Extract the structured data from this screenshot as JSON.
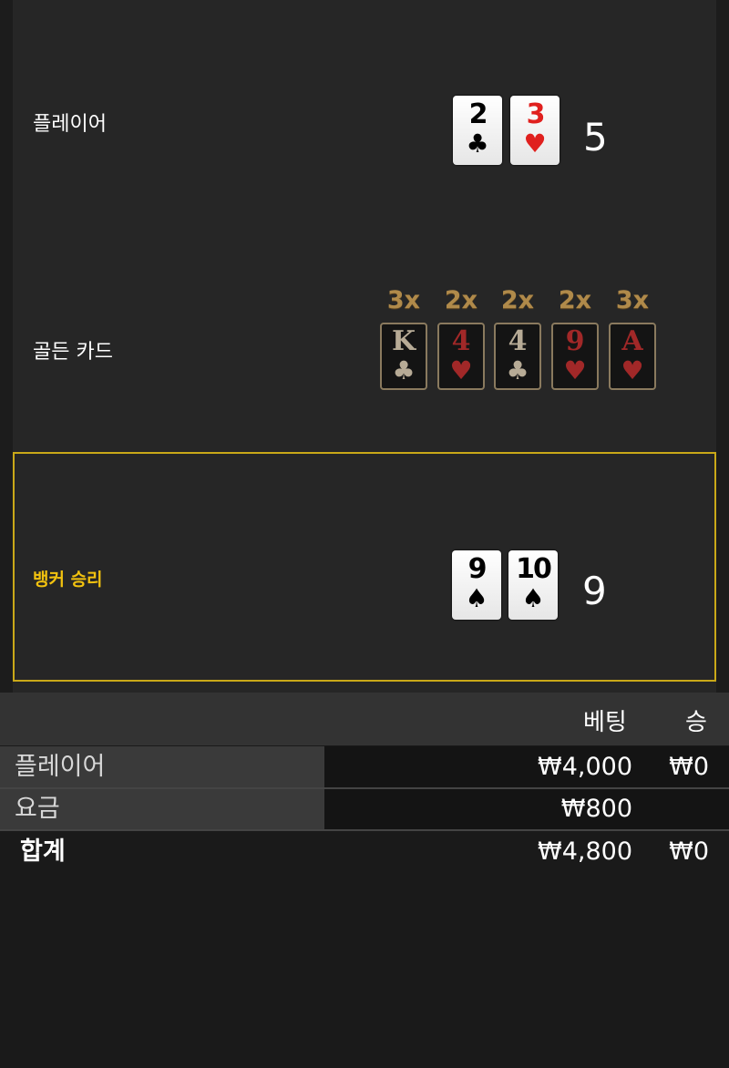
{
  "player": {
    "label": "플레이어",
    "cards": [
      {
        "rank": "2",
        "suit": "♣",
        "color": "black"
      },
      {
        "rank": "3",
        "suit": "♥",
        "color": "red"
      }
    ],
    "total": "5"
  },
  "golden": {
    "label": "골든 카드",
    "cards": [
      {
        "mult": "3x",
        "rank": "K",
        "suit": "♣",
        "color": "dark"
      },
      {
        "mult": "2x",
        "rank": "4",
        "suit": "♥",
        "color": "red"
      },
      {
        "mult": "2x",
        "rank": "4",
        "suit": "♣",
        "color": "dark"
      },
      {
        "mult": "2x",
        "rank": "9",
        "suit": "♥",
        "color": "red"
      },
      {
        "mult": "3x",
        "rank": "A",
        "suit": "♥",
        "color": "red"
      }
    ]
  },
  "banker": {
    "label": "뱅커 승리",
    "cards": [
      {
        "rank": "9",
        "suit": "♠",
        "color": "black"
      },
      {
        "rank": "10",
        "suit": "♠",
        "color": "black"
      }
    ],
    "total": "9",
    "highlight_color": "#c9a818"
  },
  "table": {
    "headers": {
      "bet": "베팅",
      "win": "승"
    },
    "rows": [
      {
        "label": "플레이어",
        "bet": "₩4,000",
        "win": "₩0"
      },
      {
        "label": "요금",
        "bet": "₩800",
        "win": ""
      }
    ],
    "total": {
      "label": "합계",
      "bet": "₩4,800",
      "win": "₩0"
    }
  }
}
